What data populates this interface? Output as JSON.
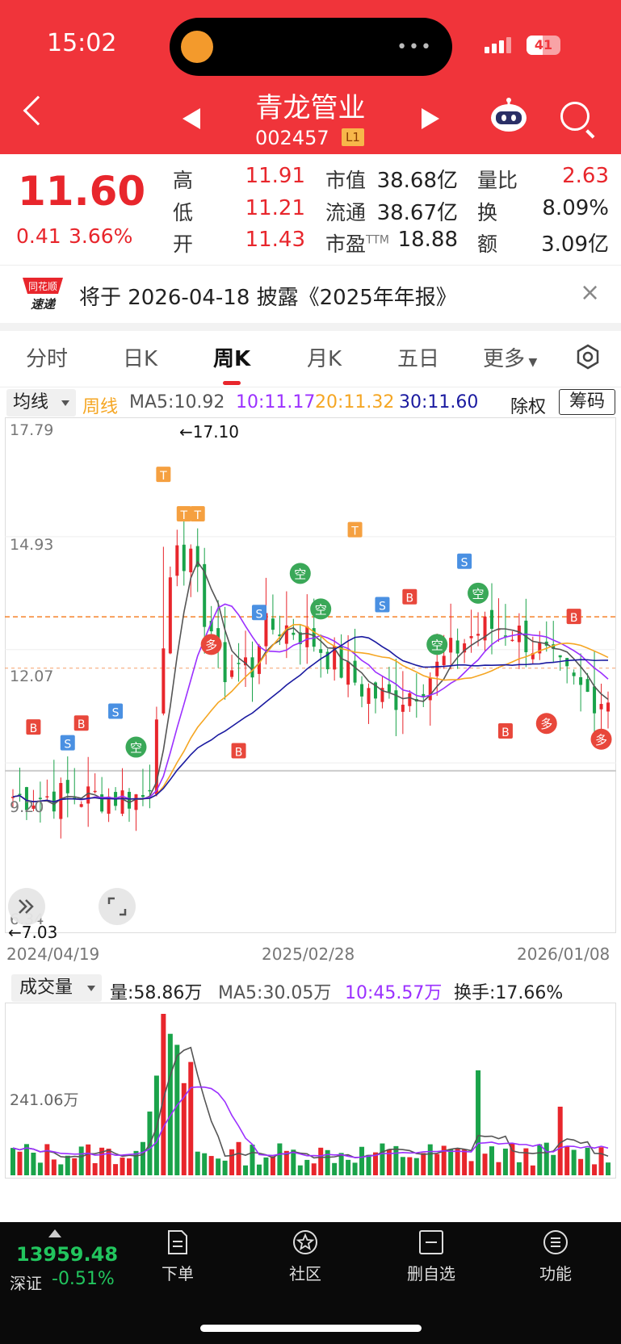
{
  "status_bar": {
    "time": "15:02",
    "battery": "41"
  },
  "header": {
    "name": "青龙管业",
    "code": "002457",
    "level": "L1"
  },
  "quote": {
    "price": "11.60",
    "change": "0.41",
    "change_pct": "3.66%",
    "rows": [
      {
        "l1": "高",
        "v1": "11.91",
        "l2": "市值",
        "v2": "38.68亿",
        "l3": "量比",
        "v3": "2.63"
      },
      {
        "l1": "低",
        "v1": "11.21",
        "l2": "流通",
        "v2": "38.67亿",
        "l3": "换",
        "v3": "8.09%"
      },
      {
        "l1": "开",
        "v1": "11.43",
        "l2": "市盈",
        "l2sub": "TTM",
        "v2": "18.88",
        "l3": "额",
        "v3": "3.09亿"
      }
    ]
  },
  "notice": {
    "logo_top": "同花顺",
    "logo_bottom": "速递",
    "text": "将于 2026-04-18 披露《2025年年报》"
  },
  "tabs": [
    "分时",
    "日K",
    "周K",
    "月K",
    "五日",
    "更多"
  ],
  "active_tab": "周K",
  "ma_bar": {
    "select": "均线",
    "period": "周线",
    "ma5": "MA5:10.92",
    "ma10": "10:11.17",
    "ma20": "20:11.32",
    "ma30": "30:11.60",
    "adjust": "除权",
    "chip": "筹码"
  },
  "chart": {
    "price_labels": [
      "17.79",
      "14.93",
      "12.07",
      "9.20",
      "6.34"
    ],
    "high_marker": "←17.10",
    "low_marker": "←7.03",
    "dates": [
      "2024/04/19",
      "2025/02/28",
      "2026/01/08"
    ],
    "colors": {
      "up": "#e8262c",
      "down": "#1aa34a",
      "ma5": "#555555",
      "ma10": "#9b30ff",
      "ma20": "#f5a623",
      "ma30": "#1a1aa0"
    }
  },
  "chart_data": {
    "type": "candlestick",
    "ylim": [
      6.34,
      17.79
    ],
    "x_range": [
      "2024/04/19",
      "2026/01/08"
    ],
    "high": 17.1,
    "low": 7.03,
    "last_close": 11.6,
    "current_price_line": 12.9
  },
  "volume": {
    "select": "成交量",
    "vol": "量:58.86万",
    "ma5": "MA5:30.05万",
    "ma10": "10:45.57万",
    "turnover": "换手:17.66%",
    "axis_label": "241.06万"
  },
  "bottom": {
    "index_value": "13959.48",
    "index_name": "深证",
    "index_change": "-0.51%",
    "nav": [
      "下单",
      "社区",
      "删自选",
      "功能"
    ]
  }
}
